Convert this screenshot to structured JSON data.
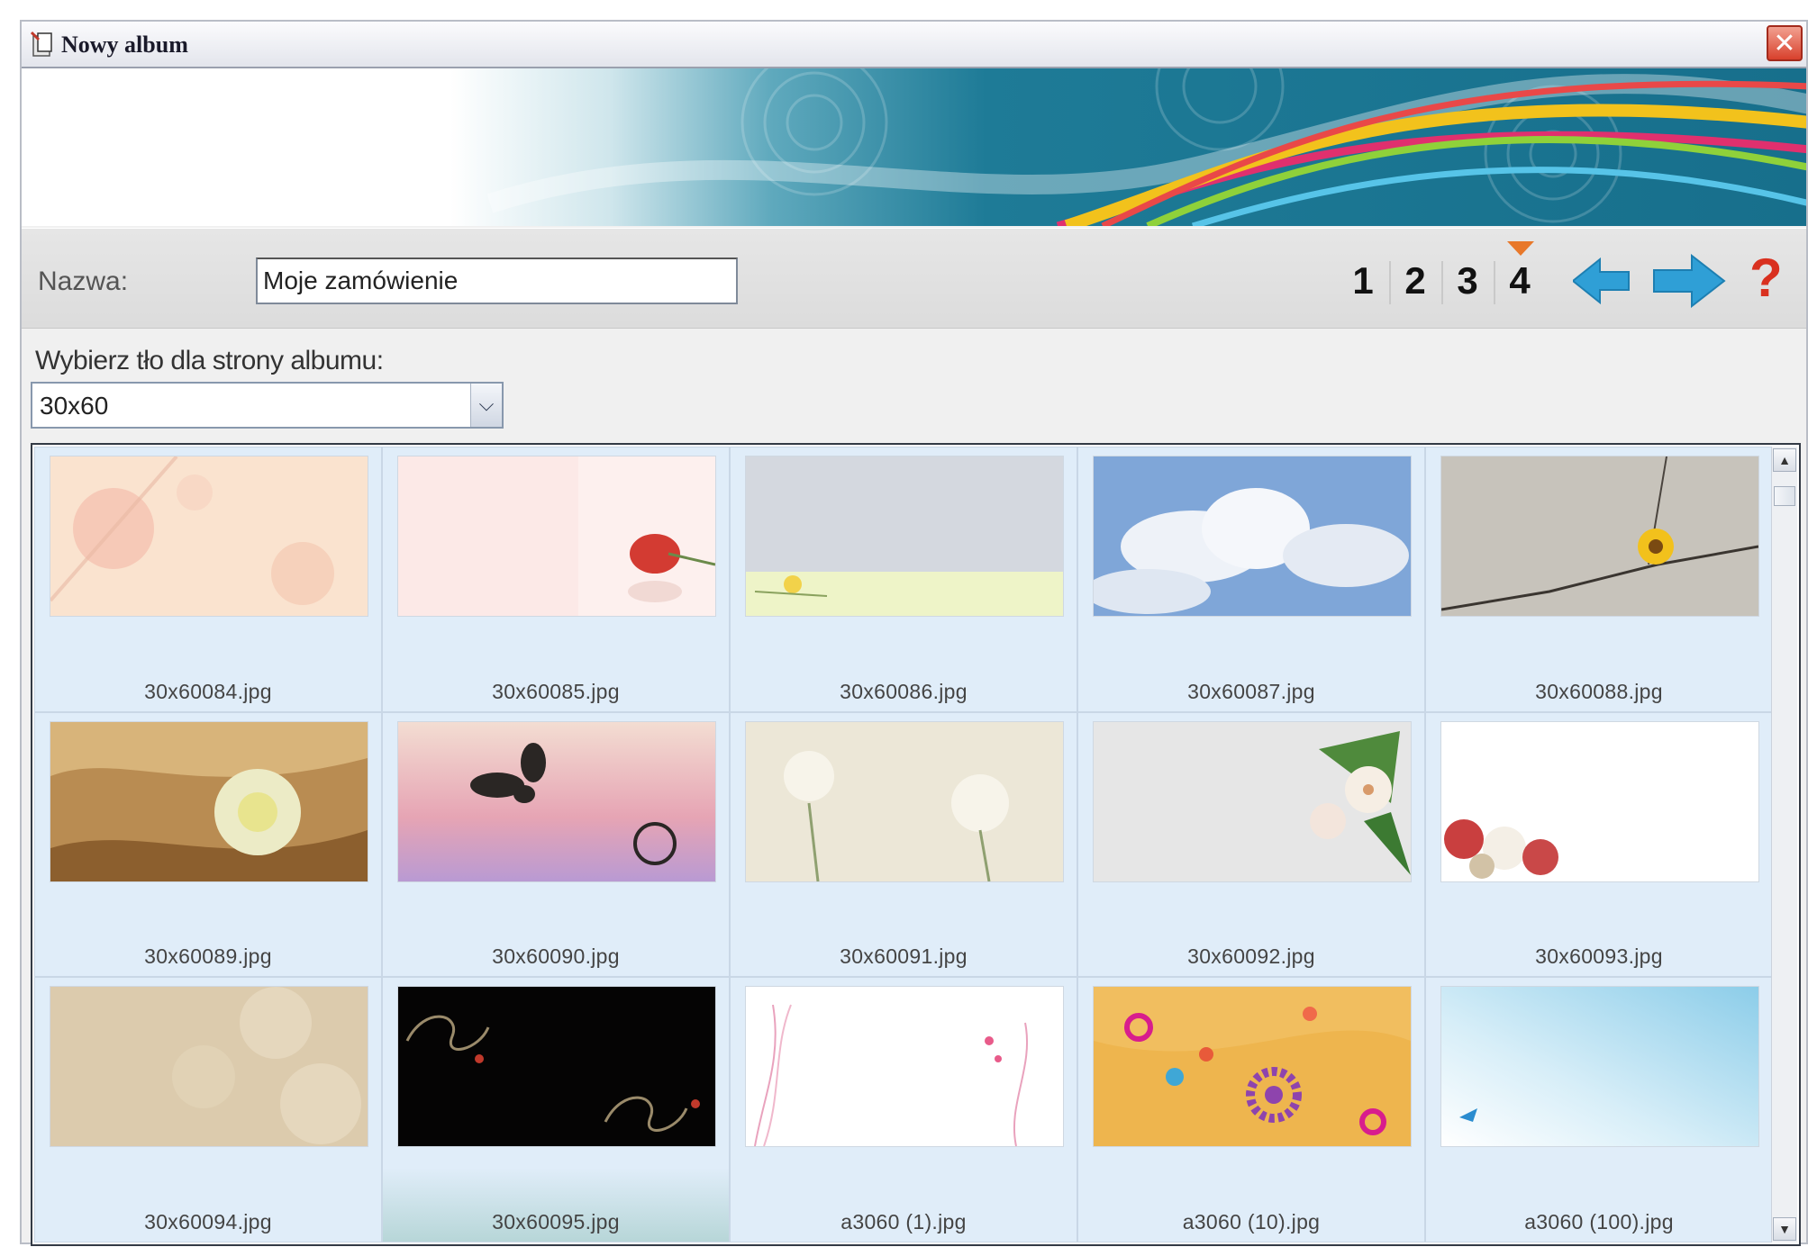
{
  "window": {
    "title": "Nowy album",
    "close_label": "✕"
  },
  "form": {
    "name_label": "Nazwa:",
    "name_value": "Moje zamówienie",
    "background_prompt": "Wybierz tło dla strony albumu:"
  },
  "steps": {
    "items": [
      "1",
      "2",
      "3",
      "4"
    ],
    "current": "4"
  },
  "nav": {
    "help_label": "?"
  },
  "select": {
    "value": "30x60"
  },
  "backgrounds": [
    {
      "file": "30x60084.jpg"
    },
    {
      "file": "30x60085.jpg"
    },
    {
      "file": "30x60086.jpg"
    },
    {
      "file": "30x60087.jpg"
    },
    {
      "file": "30x60088.jpg"
    },
    {
      "file": "30x60089.jpg"
    },
    {
      "file": "30x60090.jpg"
    },
    {
      "file": "30x60091.jpg"
    },
    {
      "file": "30x60092.jpg"
    },
    {
      "file": "30x60093.jpg"
    },
    {
      "file": "30x60094.jpg"
    },
    {
      "file": "30x60095.jpg",
      "selected": true
    },
    {
      "file": "a3060 (1).jpg"
    },
    {
      "file": "a3060 (10).jpg"
    },
    {
      "file": "a3060 (100).jpg"
    }
  ],
  "colors": {
    "accent": "#2f9fd6",
    "step_marker": "#e8782a",
    "help": "#d9301f"
  }
}
